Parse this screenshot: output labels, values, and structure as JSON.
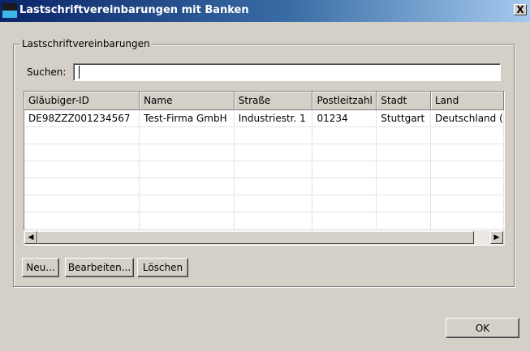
{
  "window": {
    "title": "Lastschriftvereinbarungen mit Banken",
    "close_label": "X"
  },
  "group": {
    "label": "Lastschriftvereinbarungen",
    "search_label": "Suchen:",
    "search_value": ""
  },
  "table": {
    "columns": [
      "Gläubiger-ID",
      "Name",
      "Straße",
      "Postleitzahl",
      "Stadt",
      "Land"
    ],
    "rows": [
      [
        "DE98ZZZ001234567",
        "Test-Firma GmbH",
        "Industriestr. 1",
        "01234",
        "Stuttgart",
        "Deutschland ("
      ]
    ]
  },
  "buttons": {
    "new": "Neu...",
    "edit": "Bearbeiten...",
    "delete": "Löschen",
    "ok": "OK"
  }
}
